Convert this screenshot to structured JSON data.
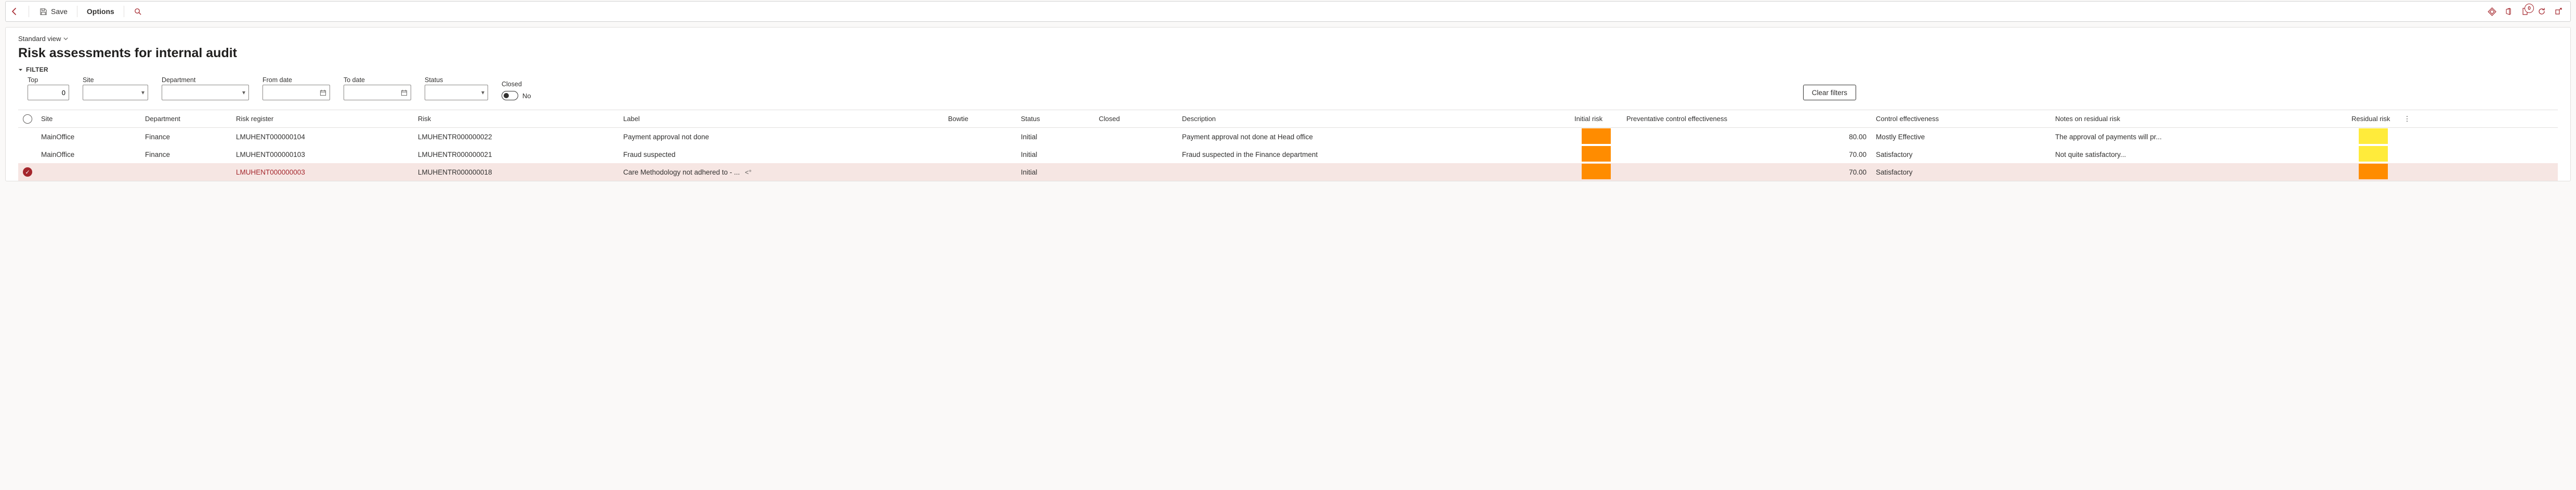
{
  "toolbar": {
    "save_label": "Save",
    "options_label": "Options",
    "badge_count": "0"
  },
  "view": {
    "current": "Standard view"
  },
  "page_title": "Risk assessments for internal audit",
  "filter": {
    "header": "FILTER",
    "top_label": "Top",
    "top_value": "0",
    "site_label": "Site",
    "dept_label": "Department",
    "from_label": "From date",
    "to_label": "To date",
    "status_label": "Status",
    "closed_label": "Closed",
    "closed_value": "No",
    "clear_label": "Clear filters"
  },
  "columns": {
    "site": "Site",
    "dept": "Department",
    "reg": "Risk register",
    "risk": "Risk",
    "label": "Label",
    "bow": "Bowtie",
    "stat": "Status",
    "clos": "Closed",
    "desc": "Description",
    "init": "Initial risk",
    "prev": "Preventative control effectiveness",
    "ceff": "Control effectiveness",
    "notes": "Notes on residual risk",
    "resid": "Residual risk"
  },
  "rows": [
    {
      "selected": false,
      "site": "MainOffice",
      "dept": "Finance",
      "reg": "LMUHENT000000104",
      "risk": "LMUHENTR000000022",
      "label": "Payment approval not done",
      "status": "Initial",
      "desc": "Payment approval not done at Head office",
      "prev": "80.00",
      "ceff": "Mostly Effective",
      "notes": "The approval of payments will pr...",
      "init_color": "orange",
      "resid_color": "yellow",
      "reg_link": false,
      "share": false
    },
    {
      "selected": false,
      "site": "MainOffice",
      "dept": "Finance",
      "reg": "LMUHENT000000103",
      "risk": "LMUHENTR000000021",
      "label": "Fraud suspected",
      "status": "Initial",
      "desc": "Fraud suspected in the Finance department",
      "prev": "70.00",
      "ceff": "Satisfactory",
      "notes": "Not quite satisfactory...",
      "init_color": "orange",
      "resid_color": "yellow",
      "reg_link": false,
      "share": false
    },
    {
      "selected": true,
      "site": "",
      "dept": "",
      "reg": "LMUHENT000000003",
      "risk": "LMUHENTR000000018",
      "label": "Care Methodology not adhered to - ...",
      "status": "Initial",
      "desc": "",
      "prev": "70.00",
      "ceff": "Satisfactory",
      "notes": "",
      "init_color": "orange",
      "resid_color": "orange",
      "reg_link": true,
      "share": true
    }
  ]
}
